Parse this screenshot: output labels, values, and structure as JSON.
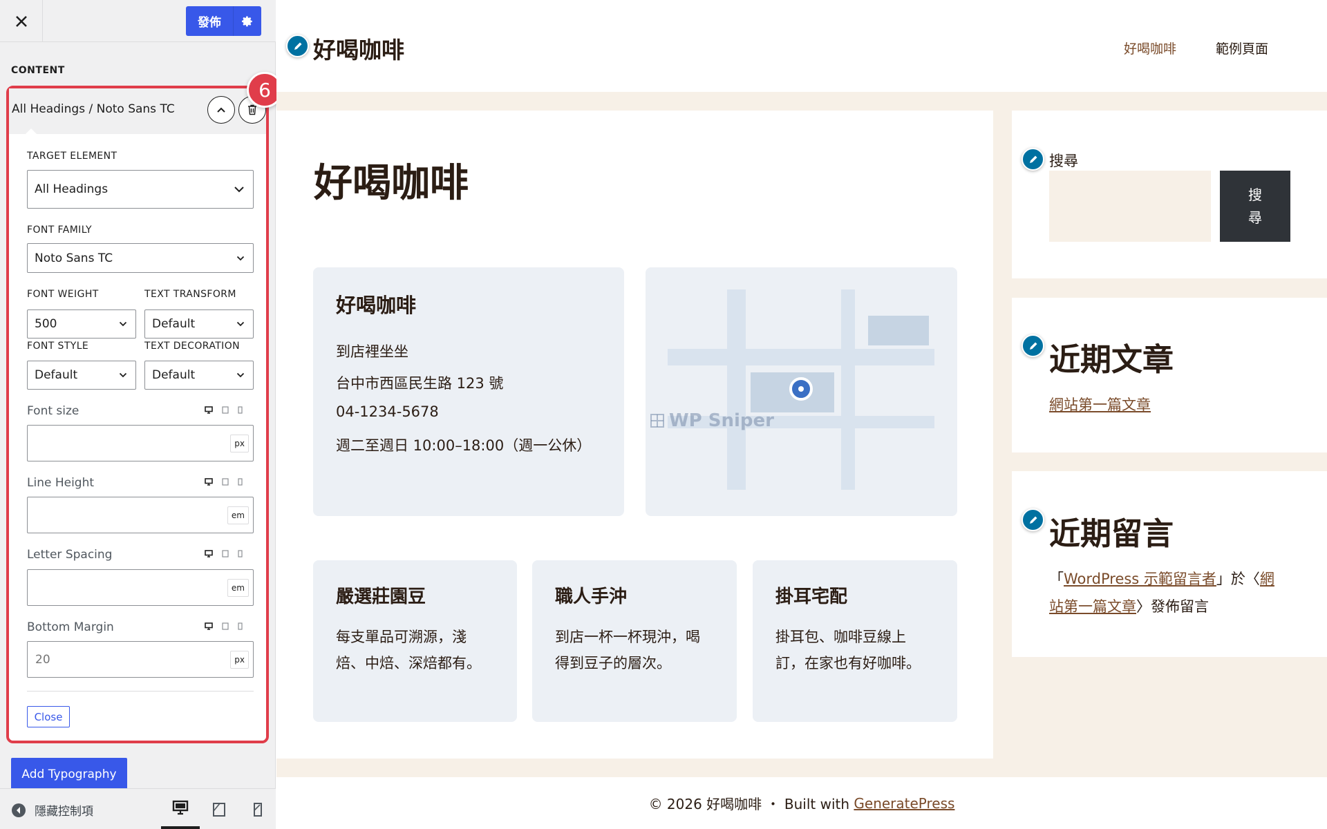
{
  "sidebar": {
    "publish_label": "發佈",
    "section_heading": "CONTENT",
    "badge": "6",
    "panel_title": "All Headings / Noto Sans TC",
    "target_element": {
      "label": "TARGET ELEMENT",
      "value": "All Headings"
    },
    "font_family": {
      "label": "FONT FAMILY",
      "value": "Noto Sans TC"
    },
    "font_weight": {
      "label": "FONT WEIGHT",
      "value": "500"
    },
    "text_transform": {
      "label": "TEXT TRANSFORM",
      "value": "Default"
    },
    "font_style": {
      "label": "FONT STYLE",
      "value": "Default"
    },
    "text_decoration": {
      "label": "TEXT DECORATION",
      "value": "Default"
    },
    "font_size": {
      "label": "Font size",
      "value": "",
      "unit": "px"
    },
    "line_height": {
      "label": "Line Height",
      "value": "",
      "unit": "em"
    },
    "letter_spacing": {
      "label": "Letter Spacing",
      "value": "",
      "unit": "em"
    },
    "bottom_margin": {
      "label": "Bottom Margin",
      "value": "20",
      "unit": "px"
    },
    "close_label": "Close",
    "add_typography_label": "Add Typography",
    "hide_controls_label": "隱藏控制項"
  },
  "site": {
    "title": "好喝咖啡",
    "nav": [
      "好喝咖啡",
      "範例頁面"
    ],
    "page_title": "好喝咖啡",
    "info_card": {
      "title": "好喝咖啡",
      "lines": [
        "到店裡坐坐",
        "台中市西區民生路 123 號",
        "04-1234-5678",
        "週二至週日 10:00–18:00（週一公休）"
      ]
    },
    "features": [
      {
        "title": "嚴選莊園豆",
        "lines": [
          "每支單品可溯源，淺",
          "焙、中焙、深焙都有。"
        ]
      },
      {
        "title": "職人手沖",
        "lines": [
          "到店一杯一杯現沖，喝",
          "得到豆子的層次。"
        ]
      },
      {
        "title": "掛耳宅配",
        "lines": [
          "掛耳包、咖啡豆線上",
          "訂，在家也有好咖啡。"
        ]
      }
    ],
    "widgets": {
      "search": {
        "title": "搜尋",
        "button_line1": "搜",
        "button_line2": "尋"
      },
      "recent_posts": {
        "title": "近期文章",
        "link": "網站第一篇文章"
      },
      "recent_comments": {
        "title": "近期留言",
        "line1_prefix": "「",
        "line1_author": "WordPress 示範留言者",
        "line1_mid": "」於〈",
        "line1_post_start": "網",
        "line2_post_end": "站第一篇文章",
        "line2_suffix": "〉發佈留言"
      }
    },
    "footer": {
      "text": "© 2026 好喝咖啡 ・ Built with ",
      "link": "GeneratePress"
    },
    "watermark": "WP Sniper"
  },
  "colors": {
    "accent": "#3858e9",
    "highlight": "#e03d4a",
    "edit_dot": "#0071a1",
    "site_bg": "#f7f0e7",
    "card_bg": "#ecf0f5"
  }
}
